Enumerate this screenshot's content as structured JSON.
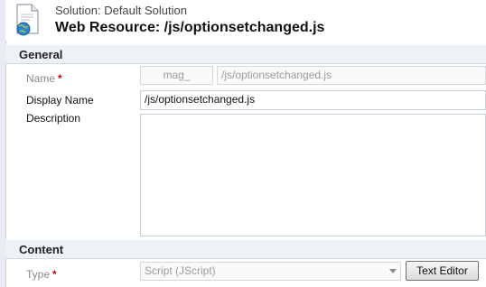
{
  "header": {
    "solution_text": "Solution: Default Solution",
    "title": "Web Resource: /js/optionsetchanged.js",
    "icon": "web-resource-document-icon"
  },
  "general": {
    "section_title": "General",
    "name_label": "Name",
    "required_marker": "*",
    "name_prefix": "mag_",
    "name_value": "/js/optionsetchanged.js",
    "display_name_label": "Display Name",
    "display_name_value": "/js/optionsetchanged.js",
    "description_label": "Description",
    "description_value": ""
  },
  "content": {
    "section_title": "Content",
    "type_label": "Type",
    "required_marker": "*",
    "type_value": "Script (JScript)",
    "text_editor_button": "Text Editor"
  }
}
